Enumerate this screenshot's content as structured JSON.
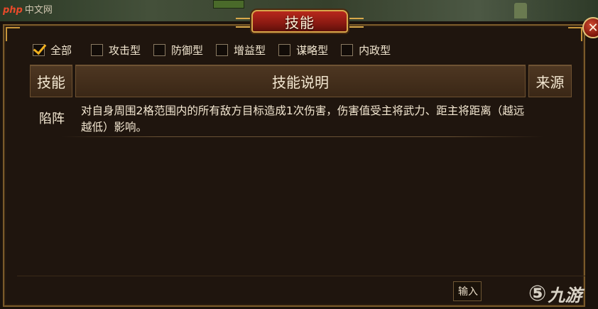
{
  "watermark": {
    "brand": "php",
    "cn": "中文网"
  },
  "dialog": {
    "title": "技能",
    "close_symbol": "✕"
  },
  "filters": [
    {
      "label": "全部",
      "checked": true
    },
    {
      "label": "攻击型",
      "checked": false
    },
    {
      "label": "防御型",
      "checked": false
    },
    {
      "label": "增益型",
      "checked": false
    },
    {
      "label": "谋略型",
      "checked": false
    },
    {
      "label": "内政型",
      "checked": false
    }
  ],
  "table": {
    "headers": {
      "skill": "技能",
      "description": "技能说明",
      "source": "来源"
    },
    "rows": [
      {
        "skill": "陷阵",
        "description": "对自身周围2格范围内的所有敌方目标造成1次伤害，伤害值受主将武力、距主将距离（越远越低）影响。",
        "source": ""
      }
    ]
  },
  "footer": {
    "input_label": "输入",
    "logo_mark": "⑤",
    "logo_text": "九游"
  },
  "colors": {
    "accent_gold": "#d8a84a",
    "title_red": "#b8281c",
    "check_orange": "#f0b020",
    "text": "#f4e8d2"
  },
  "icons": {
    "close": "close-icon",
    "check": "checkmark-icon"
  }
}
